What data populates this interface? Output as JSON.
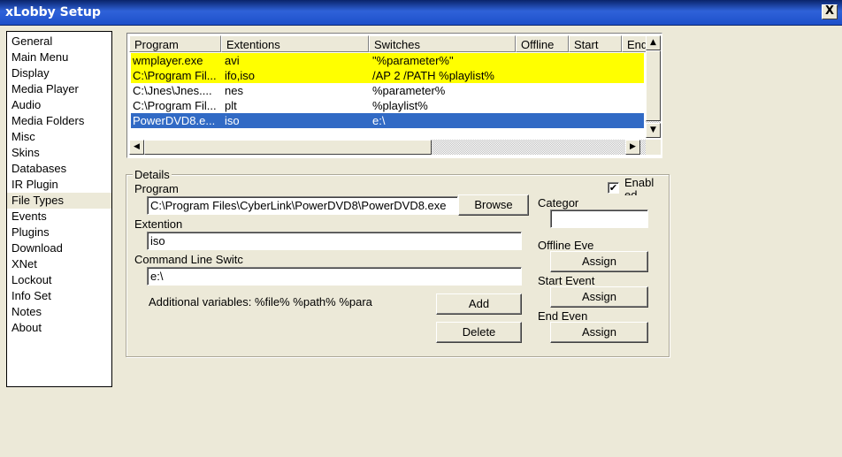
{
  "window": {
    "title": "xLobby Setup",
    "close_glyph": "X"
  },
  "nav": {
    "items": [
      {
        "label": "General"
      },
      {
        "label": "Main Menu"
      },
      {
        "label": "Display"
      },
      {
        "label": "Media Player"
      },
      {
        "label": "Audio"
      },
      {
        "label": "Media Folders"
      },
      {
        "label": "Misc"
      },
      {
        "label": "Skins"
      },
      {
        "label": "Databases"
      },
      {
        "label": "IR Plugin"
      },
      {
        "label": "File Types"
      },
      {
        "label": "Events"
      },
      {
        "label": "Plugins"
      },
      {
        "label": "Download"
      },
      {
        "label": "XNet"
      },
      {
        "label": "Lockout"
      },
      {
        "label": "Info Set"
      },
      {
        "label": "Notes"
      },
      {
        "label": "About"
      }
    ],
    "selected": "File Types"
  },
  "table": {
    "columns": [
      "Program",
      "Extentions",
      "Switches",
      "Offline",
      "Start",
      "End"
    ],
    "rows": [
      {
        "program": "wmplayer.exe",
        "ext": "avi",
        "switches": "\"%parameter%\"",
        "style": "yellow"
      },
      {
        "program": "C:\\Program Fil...",
        "ext": "ifo,iso",
        "switches": "/AP 2 /PATH %playlist%",
        "style": "yellow"
      },
      {
        "program": "C:\\Jnes\\Jnes....",
        "ext": "nes",
        "switches": "%parameter%",
        "style": "normal"
      },
      {
        "program": "C:\\Program Fil...",
        "ext": "plt",
        "switches": "%playlist%",
        "style": "normal"
      },
      {
        "program": "PowerDVD8.e...",
        "ext": "iso",
        "switches": "e:\\",
        "style": "selected"
      }
    ],
    "scroll_up_glyph": "▲",
    "scroll_down_glyph": "▼",
    "scroll_left_glyph": "◀",
    "scroll_right_glyph": "▶"
  },
  "details": {
    "legend": "Details",
    "program_label": "Program",
    "program_value": "C:\\Program Files\\CyberLink\\PowerDVD8\\PowerDVD8.exe",
    "browse_label": "Browse",
    "extention_label": "Extention",
    "extention_value": "iso",
    "cmdline_label": "Command Line Switc",
    "cmdline_value": "e:\\",
    "additional_vars": "Additional variables: %file% %path% %para",
    "add_label": "Add",
    "delete_label": "Delete",
    "enabled_label": "Enabled",
    "enabled_checked": true,
    "check_glyph": "✔",
    "category_label": "Categor",
    "category_value": "",
    "offline_event_label": "Offline Eve",
    "start_event_label": "Start Event",
    "end_event_label": "End Even",
    "assign_label": "Assign"
  }
}
